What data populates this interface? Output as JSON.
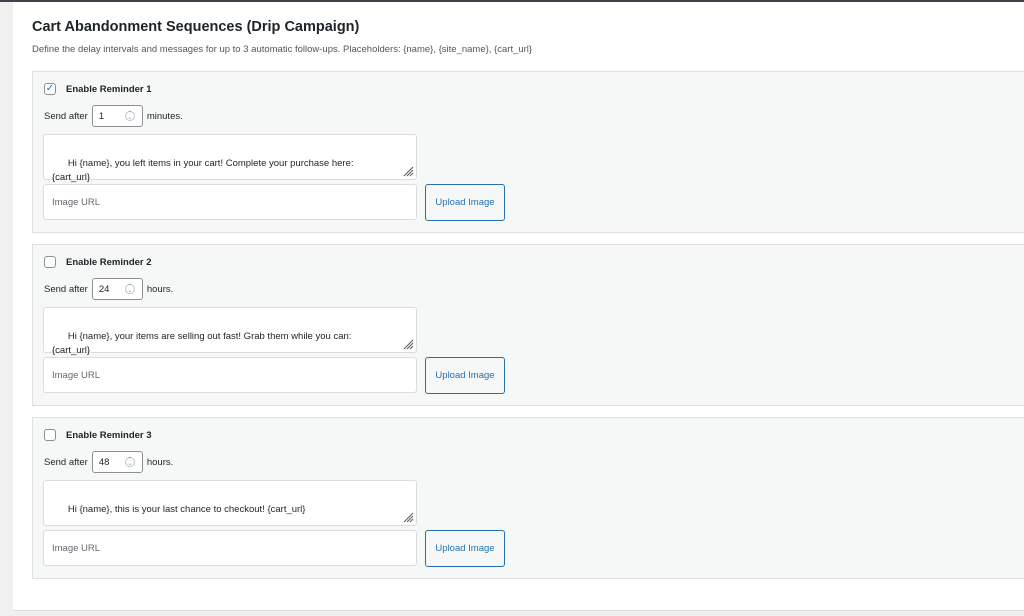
{
  "section": {
    "title": "Cart Abandonment Sequences (Drip Campaign)",
    "description": "Define the delay intervals and messages for up to 3 automatic follow-ups. Placeholders: {name}, {site_name}, {cart_url}"
  },
  "common": {
    "send_after_label": "Send after",
    "image_url_placeholder": "Image URL",
    "upload_button_label": "Upload Image"
  },
  "reminders": [
    {
      "enable_label": "Enable Reminder 1",
      "enabled": true,
      "delay_value": "1",
      "delay_unit": "minutes.",
      "message": "Hi {name}, you left items in your cart! Complete your purchase here:\n{cart_url}"
    },
    {
      "enable_label": "Enable Reminder 2",
      "enabled": false,
      "delay_value": "24",
      "delay_unit": "hours.",
      "message": "Hi {name}, your items are selling out fast! Grab them while you can:\n{cart_url}"
    },
    {
      "enable_label": "Enable Reminder 3",
      "enabled": false,
      "delay_value": "48",
      "delay_unit": "hours.",
      "message": "Hi {name}, this is your last chance to checkout! {cart_url}"
    }
  ],
  "colors": {
    "accent": "#2271b1",
    "panel_bg": "#ffffff",
    "reminder_bg": "#f6f7f7"
  }
}
